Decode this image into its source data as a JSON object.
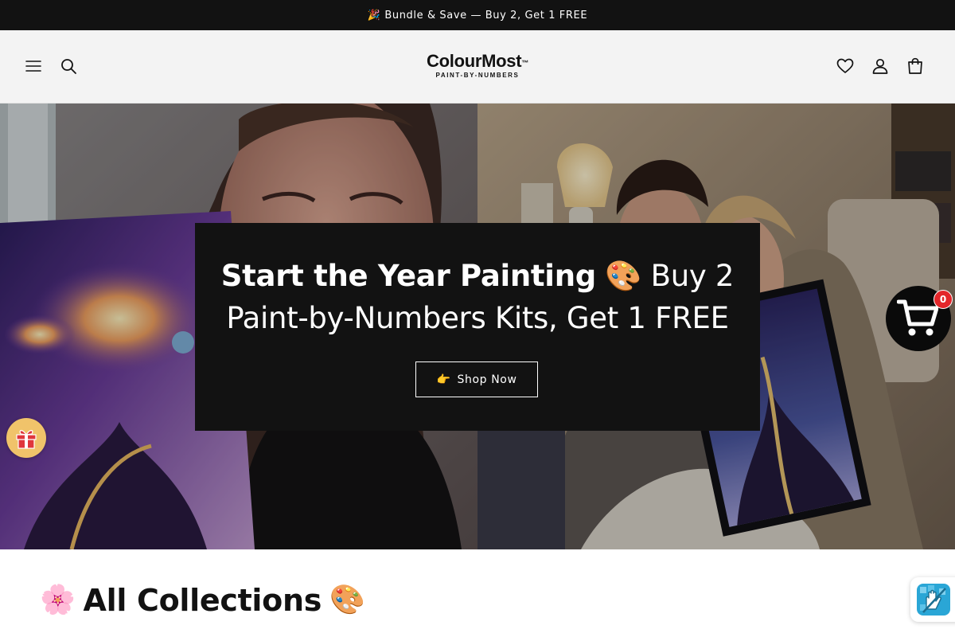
{
  "announcement": {
    "text": "🎉 Bundle & Save — Buy 2, Get 1 FREE"
  },
  "header": {
    "logo_main": "ColourMost",
    "logo_tm": "™",
    "logo_sub": "PAINT-BY-NUMBERS",
    "icons": [
      "menu-icon",
      "search-icon",
      "heart-icon",
      "account-icon",
      "bag-icon"
    ]
  },
  "hero": {
    "heading_bold": "Start the Year Painting",
    "heading_emoji": "🎨",
    "heading_rest": "Buy 2 Paint-by-Numbers Kits, Get 1 FREE",
    "button_emoji": "👉",
    "button_label": "Shop Now"
  },
  "floating": {
    "cart_count": "0",
    "gift_icon": "gift-icon",
    "cart_icon": "shopping-cart-icon",
    "accessibility_icon": "accessibility-hand-icon"
  },
  "collections": {
    "emoji_left": "🌸",
    "title": "All Collections",
    "emoji_right": "🎨"
  },
  "colors": {
    "announcement_bg": "#121212",
    "header_bg": "#f3f3f3",
    "hero_card_bg": "#121212",
    "cart_badge": "#e3262a",
    "gift_button": "#f0c36a"
  }
}
